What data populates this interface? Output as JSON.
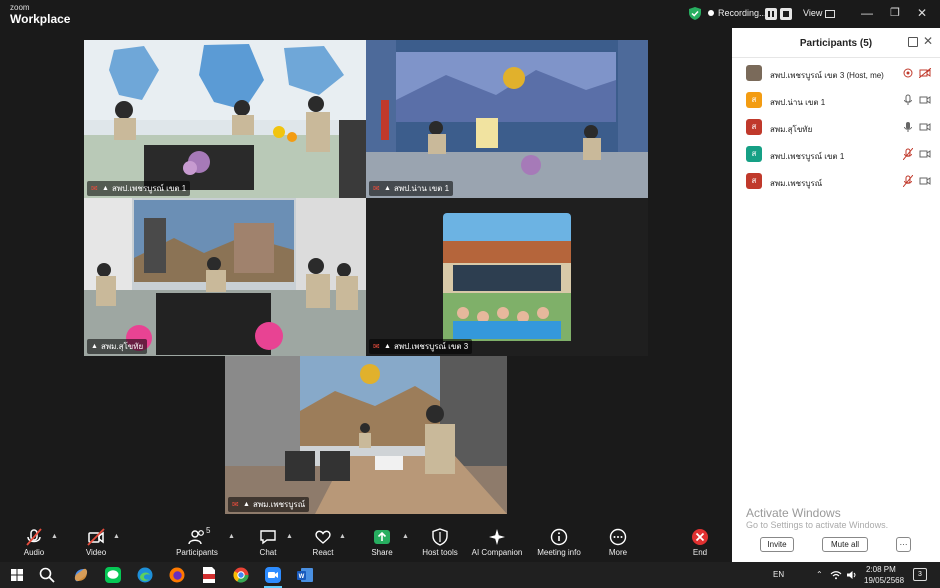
{
  "app": {
    "logo_small": "zoom",
    "logo_big": "Workplace"
  },
  "titlebar": {
    "recording": "Recording...",
    "view": "View"
  },
  "tiles": [
    {
      "name": "สพป.เพชรบูรณ์ เขต 1"
    },
    {
      "name": "สพป.น่าน เขต 1"
    },
    {
      "name": "สพม.สุโขทัย"
    },
    {
      "name": "สพป.เพชรบูรณ์ เขต 3"
    },
    {
      "name": "สพม.เพชรบูรณ์"
    }
  ],
  "panel": {
    "title": "Participants (5)",
    "participants": [
      {
        "name": "สพป.เพชรบูรณ์ เขต 3 (Host, me)",
        "avatar": "",
        "color": "#7a6a5a"
      },
      {
        "name": "สพป.น่าน เขต 1",
        "avatar": "ส",
        "color": "#f39c12"
      },
      {
        "name": "สพม.สุโขทัย",
        "avatar": "ส",
        "color": "#c0392b"
      },
      {
        "name": "สพป.เพชรบูรณ์ เขต 1",
        "avatar": "ส",
        "color": "#16a085"
      },
      {
        "name": "สพม.เพชรบูรณ์",
        "avatar": "ส",
        "color": "#c0392b"
      }
    ],
    "activate_title": "Activate Windows",
    "activate_sub": "Go to Settings to activate Windows.",
    "invite": "Invite",
    "mute_all": "Mute all",
    "more": "···"
  },
  "toolbar": {
    "audio": "Audio",
    "video": "Video",
    "participants": "Participants",
    "participants_count": "5",
    "chat": "Chat",
    "react": "React",
    "share": "Share",
    "host_tools": "Host tools",
    "ai_companion": "AI Companion",
    "meeting_info": "Meeting info",
    "more": "More",
    "end": "End"
  },
  "taskbar": {
    "lang": "EN",
    "time": "2:08 PM",
    "date": "19/05/2568",
    "notif": "3"
  }
}
